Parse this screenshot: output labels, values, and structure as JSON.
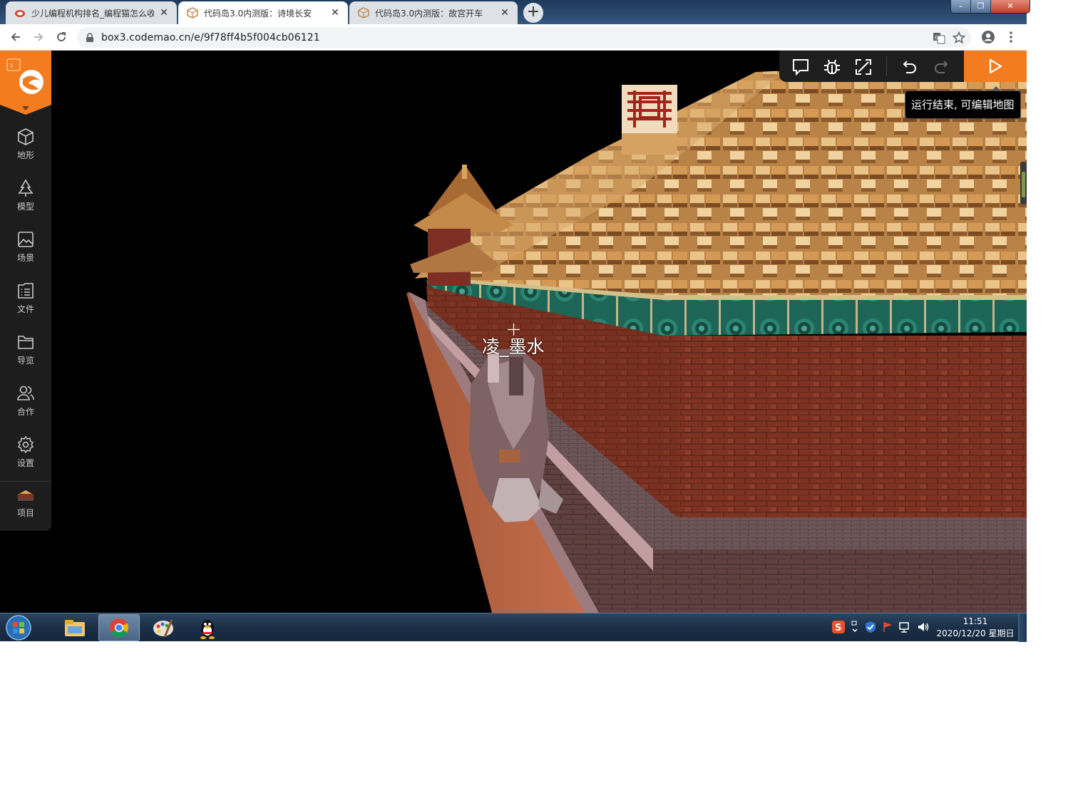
{
  "browser": {
    "tabs": [
      {
        "title": "少儿编程机构排名_编程猫怎么收",
        "active": false
      },
      {
        "title": "代码岛3.0内测版：诗境长安",
        "active": true
      },
      {
        "title": "代码岛3.0内测版：故宫开车",
        "active": false
      }
    ],
    "new_tab_label": "+",
    "window_controls": {
      "minimize": "–",
      "maximize": "❐",
      "close": "✕"
    },
    "url": "box3.codemao.cn/e/9f78ff4b5f004cb06121"
  },
  "sidebar": {
    "items": [
      {
        "label": "地形",
        "icon": "cube-icon"
      },
      {
        "label": "模型",
        "icon": "tree-icon"
      },
      {
        "label": "场景",
        "icon": "image-icon"
      },
      {
        "label": "文件",
        "icon": "file-list-icon"
      },
      {
        "label": "导览",
        "icon": "folder-icon"
      },
      {
        "label": "合作",
        "icon": "users-icon"
      },
      {
        "label": "设置",
        "icon": "gear-icon"
      },
      {
        "label": "项目",
        "icon": "project-thumbnail-icon"
      }
    ]
  },
  "editor_toolbar": {
    "buttons": [
      "comment-icon",
      "bug-icon",
      "fullscreen-icon",
      "undo-icon",
      "redo-icon"
    ],
    "run_icon": "play-icon",
    "tooltip": "运行结束, 可编辑地图"
  },
  "scene": {
    "player_name": "凌_墨水"
  },
  "taskbar": {
    "apps": [
      "explorer-icon",
      "chrome-icon",
      "paint-icon",
      "qq-icon"
    ],
    "time": "11:51",
    "date": "2020/12/20 星期日"
  },
  "colors": {
    "accent": "#f47c20",
    "sidebar": "#1d1d1d",
    "wall_red": "#8a3a27",
    "roof_gold": "#d9a65c",
    "teal_frieze": "#1e6a5e"
  }
}
